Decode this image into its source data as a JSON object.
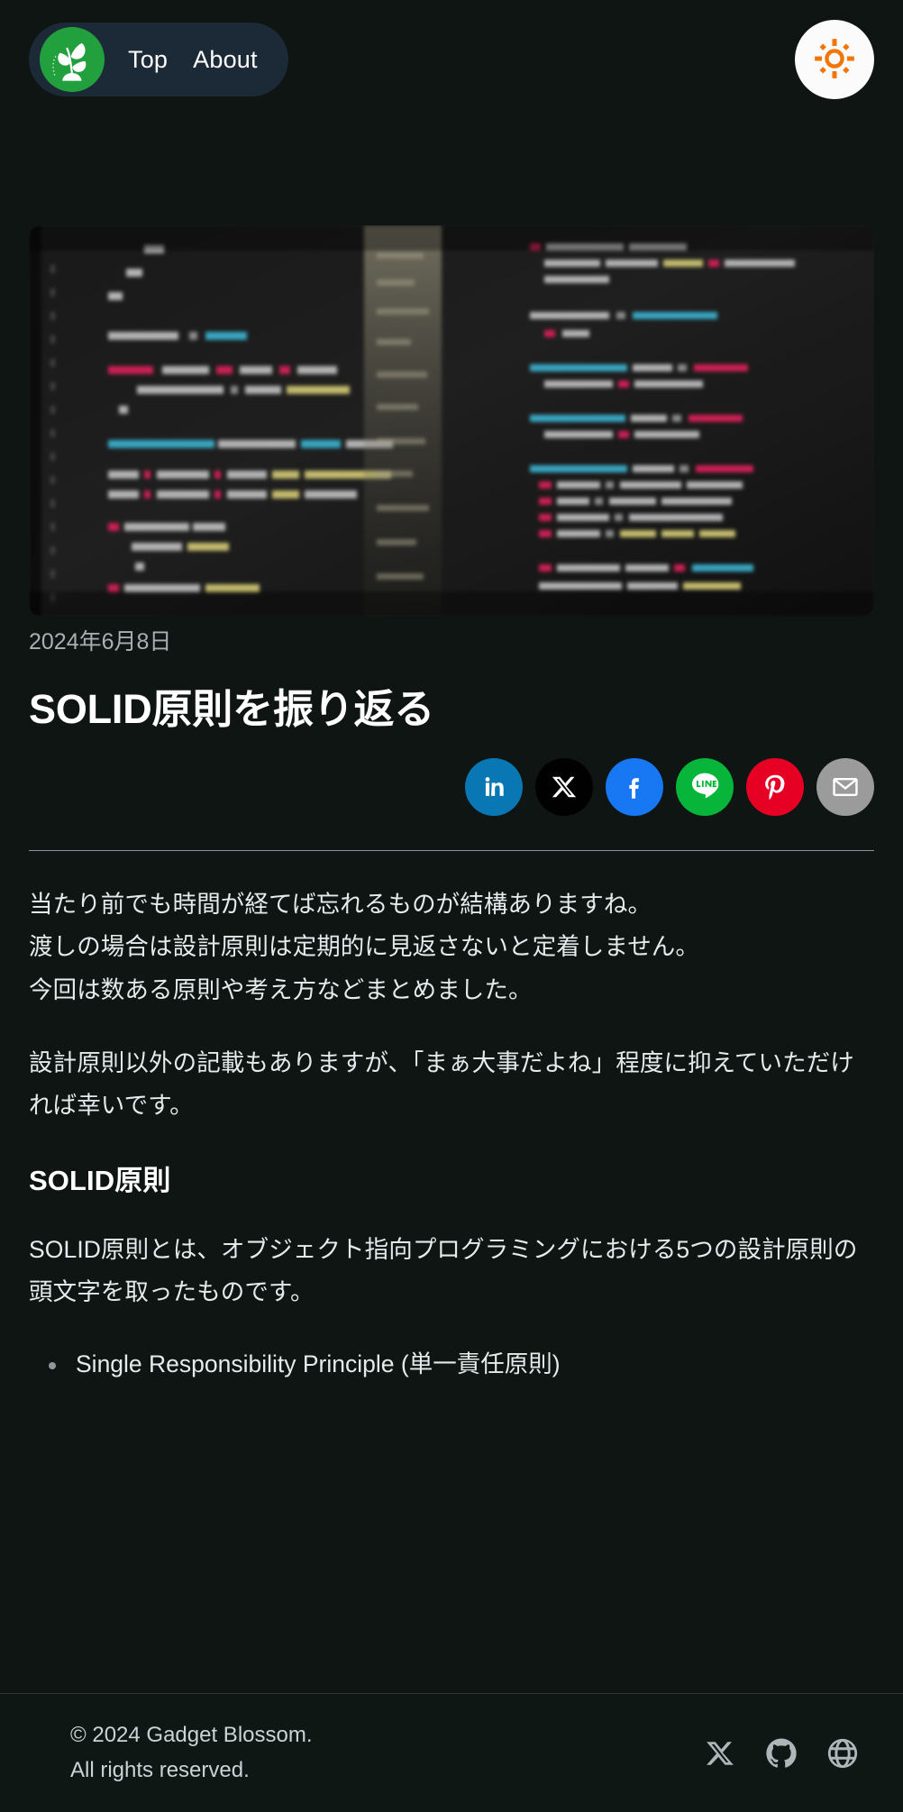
{
  "header": {
    "logo_icon": "sprout-logo-icon",
    "nav": [
      {
        "label": "Top"
      },
      {
        "label": "About"
      }
    ],
    "theme_toggle": {
      "icon": "sun-icon",
      "color": "#f2750a"
    }
  },
  "hero": {
    "image_alt": "blurred photo of source code on a monitor",
    "icon": "code-screenshot-image"
  },
  "post": {
    "date": "2024年6月8日",
    "title": "SOLID原則を振り返る",
    "share": [
      {
        "name": "linkedin",
        "label": "in",
        "color": "#0a77b5"
      },
      {
        "name": "x-twitter",
        "label": "X",
        "color": "#010101"
      },
      {
        "name": "facebook",
        "label": "f",
        "color": "#1877f2"
      },
      {
        "name": "line",
        "label": "LINE",
        "color": "#07b53b"
      },
      {
        "name": "pinterest",
        "label": "P",
        "color": "#e60023"
      },
      {
        "name": "email",
        "label": "✉",
        "color": "#9b9b9b"
      }
    ],
    "body": {
      "paragraph_1_line_1": "当たり前でも時間が経てば忘れるものが結構ありますね。",
      "paragraph_1_line_2": "渡しの場合は設計原則は定期的に見返さないと定着しません。",
      "paragraph_1_line_3": "今回は数ある原則や考え方などまとめました。",
      "paragraph_2": "設計原則以外の記載もありますが、「まぁ大事だよね」程度に抑えていただければ幸いです。",
      "heading_1": "SOLID原則",
      "paragraph_3": "SOLID原則とは、オブジェクト指向プログラミングにおける5つの設計原則の頭文字を取ったものです。",
      "list": [
        "Single Responsibility Principle (単一責任原則)"
      ]
    }
  },
  "footer": {
    "copyright_line_1": "© 2024 Gadget Blossom.",
    "copyright_line_2": "All rights reserved.",
    "social": [
      {
        "name": "x-twitter-icon"
      },
      {
        "name": "github-icon"
      },
      {
        "name": "website-globe-icon"
      }
    ]
  },
  "theme": {
    "background": "#0e1512",
    "nav_pill": "#1c2a37",
    "accent_green": "#23a03e",
    "accent_orange": "#f2750a",
    "text": "#e8eced",
    "muted_text": "#a8b0b4"
  }
}
